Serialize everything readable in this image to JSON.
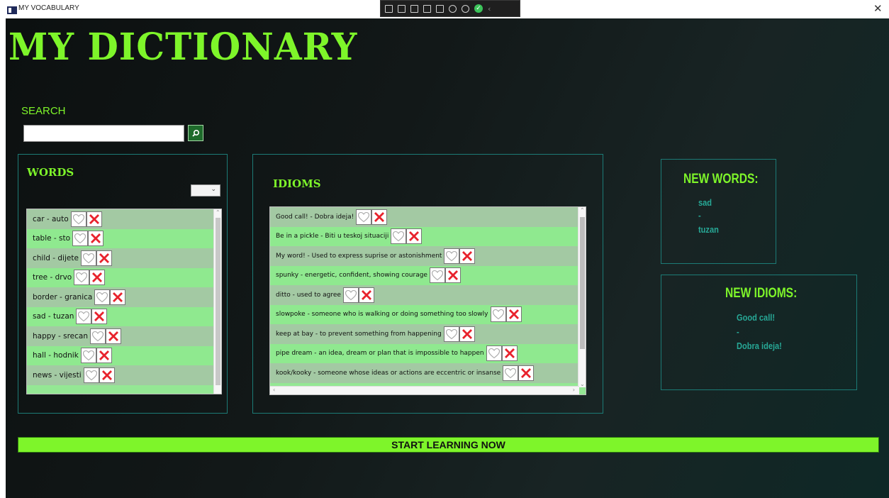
{
  "window": {
    "title": "MY VOCABULARY"
  },
  "header": {
    "title": "MY DICTIONARY"
  },
  "search": {
    "label": "SEARCH",
    "value": "",
    "placeholder": ""
  },
  "words": {
    "title": "WORDS",
    "items": [
      "car - auto",
      "table - sto",
      "child - dijete",
      "tree - drvo",
      "border - granica",
      "sad - tuzan",
      "happy - srecan",
      "hall - hodnik",
      "news - vijesti"
    ]
  },
  "idioms": {
    "title": "IDIOMS",
    "items": [
      "Good call! - Dobra ideja!",
      "Be in a pickle - Biti u teskoj situaciji",
      "My word! - Used to express suprise or astonishment",
      "spunky - energetic, confident, showing courage",
      "ditto - used to agree",
      "slowpoke - someone who is walking or doing something too slowly",
      "keep at bay - to prevent something from happening",
      "pipe dream - an idea, dream or plan that is impossible to happen",
      "kook/kooky - someone whose ideas or actions are eccentric or insanse"
    ]
  },
  "new_words": {
    "title": "NEW WORDS:",
    "word": "sad",
    "separator": "-",
    "translation": "tuzan"
  },
  "new_idioms": {
    "title": "NEW IDIOMS:",
    "idiom": "Good call!",
    "separator": "-",
    "translation": "Dobra ideja!"
  },
  "start_button": {
    "label": "START LEARNING NOW"
  },
  "colors": {
    "accent": "#7ef52a",
    "teal_text": "#27a896",
    "border": "#1c7b76",
    "row_odd": "#a3c9a3",
    "row_even": "#8fe98f"
  },
  "icons": {
    "favorite": "heart-icon",
    "delete": "close-icon",
    "search": "search-icon"
  }
}
